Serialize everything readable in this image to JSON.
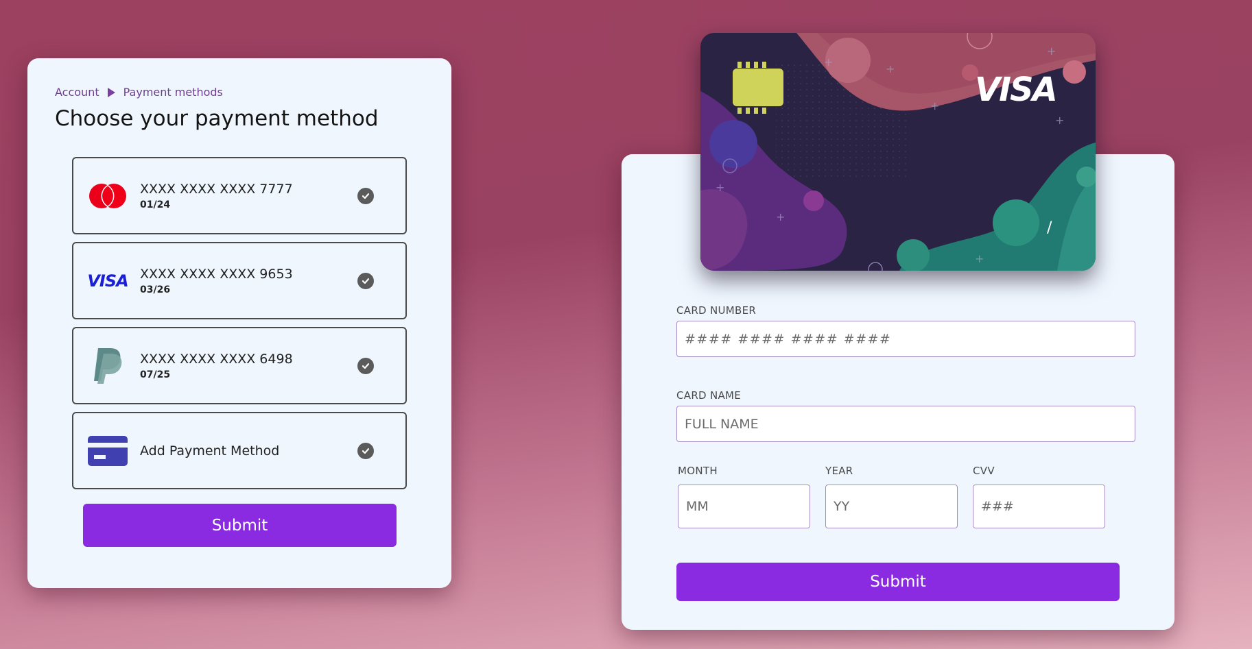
{
  "breadcrumb": {
    "items": [
      "Account",
      "Payment methods"
    ]
  },
  "title": "Choose your payment method",
  "payment_methods": [
    {
      "brand": "mastercard",
      "icon": "mastercard-icon",
      "number": "XXXX XXXX XXXX 7777",
      "expiry": "01/24"
    },
    {
      "brand": "visa",
      "icon": "visa-logo-icon",
      "logo_text": "VISA",
      "number": "XXXX XXXX XXXX 9653",
      "expiry": "03/26"
    },
    {
      "brand": "paypal",
      "icon": "paypal-icon",
      "number": "XXXX XXXX XXXX 6498",
      "expiry": "07/25"
    },
    {
      "brand": "add",
      "icon": "credit-card-icon",
      "label": "Add Payment Method"
    }
  ],
  "left_submit_label": "Submit",
  "card_preview": {
    "brand_text": "VISA",
    "expiry_separator": "/"
  },
  "form": {
    "card_number": {
      "label": "CARD NUMBER",
      "placeholder": "#### #### #### ####"
    },
    "card_name": {
      "label": "CARD NAME",
      "placeholder": "FULL NAME"
    },
    "month": {
      "label": "MONTH",
      "placeholder": "MM"
    },
    "year": {
      "label": "YEAR",
      "placeholder": "YY"
    },
    "cvv": {
      "label": "CVV",
      "placeholder": "###"
    },
    "submit_label": "Submit"
  },
  "colors": {
    "accent": "#8a2be2",
    "panel": "#eff6fe",
    "chip": "#cfd35a"
  }
}
